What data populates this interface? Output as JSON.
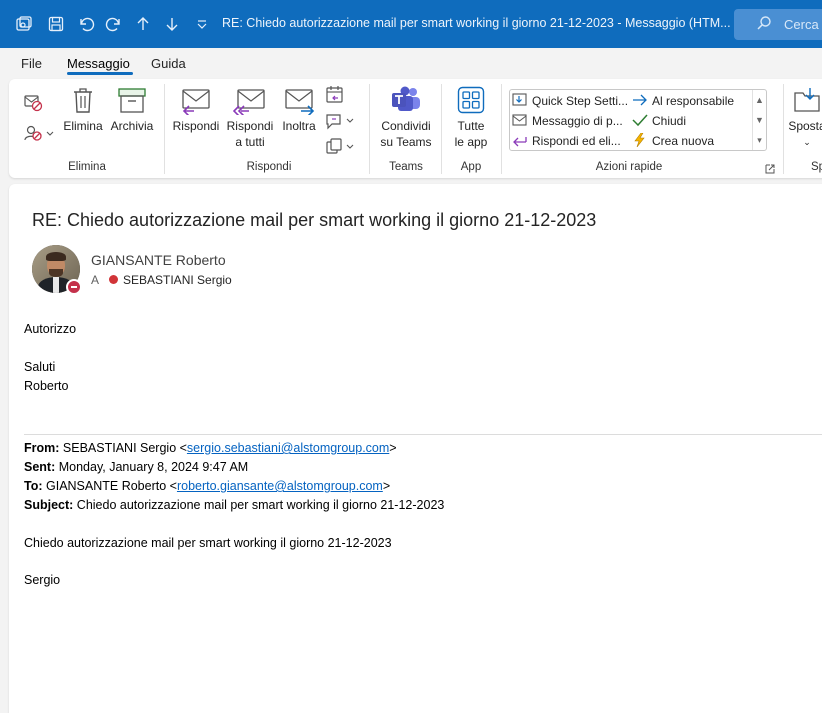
{
  "titlebar": {
    "title": "RE: Chiedo autorizzazione mail per  smart working il giorno 21-12-2023  -  Messaggio (HTM...",
    "search_placeholder": "Cerca",
    "icons": [
      "new-window-icon",
      "save-icon",
      "undo-icon",
      "redo-icon",
      "previous-icon",
      "next-icon",
      "customize-qat-icon"
    ]
  },
  "menu": {
    "tabs": [
      {
        "label": "File",
        "active": false
      },
      {
        "label": "Messaggio",
        "active": true
      },
      {
        "label": "Guida",
        "active": false
      }
    ]
  },
  "ribbon": {
    "groups": {
      "elimina": "Elimina",
      "rispondi": "Rispondi",
      "teams": "Teams",
      "app": "App",
      "azioni_rapide": "Azioni rapide"
    },
    "buttons": {
      "elimina": "Elimina",
      "archivia": "Archivia",
      "rispondi": "Rispondi",
      "rispondi_tutti_1": "Rispondi",
      "rispondi_tutti_2": "a tutti",
      "inoltra": "Inoltra",
      "condividi_1": "Condividi",
      "condividi_2": "su Teams",
      "tutte_1": "Tutte",
      "tutte_2": "le app",
      "sposta": "Sposta"
    },
    "quick_steps": {
      "col1": [
        "Quick Step Setti...",
        "Messaggio di p...",
        "Rispondi ed eli..."
      ],
      "col2": [
        "Al responsabile",
        "Chiudi",
        "Crea nuova"
      ]
    },
    "accent": "#0f6cbd"
  },
  "message": {
    "subject": "RE: Chiedo autorizzazione mail per  smart working il giorno 21-12-2023",
    "sender": "GIANSANTE Roberto",
    "to_label": "A",
    "recipient": "SEBASTIANI Sergio",
    "body": {
      "line1": "Autorizzo",
      "line2": "Saluti",
      "line3": "Roberto"
    },
    "quoted": {
      "from_label": "From:",
      "from_name": "SEBASTIANI Sergio <",
      "from_email": "sergio.sebastiani@alstomgroup.com",
      "from_close": ">",
      "sent_label": "Sent:",
      "sent_value": "Monday, January 8, 2024 9:47 AM",
      "to_label": "To:",
      "to_name": "GIANSANTE Roberto <",
      "to_email": "roberto.giansante@alstomgroup.com",
      "to_close": ">",
      "subject_label": "Subject:",
      "subject_value": "Chiedo autorizzazione mail per smart working il giorno 21-12-2023",
      "body1": "Chiedo autorizzazione mail per smart working il giorno 21-12-2023",
      "body2": "Sergio"
    }
  }
}
